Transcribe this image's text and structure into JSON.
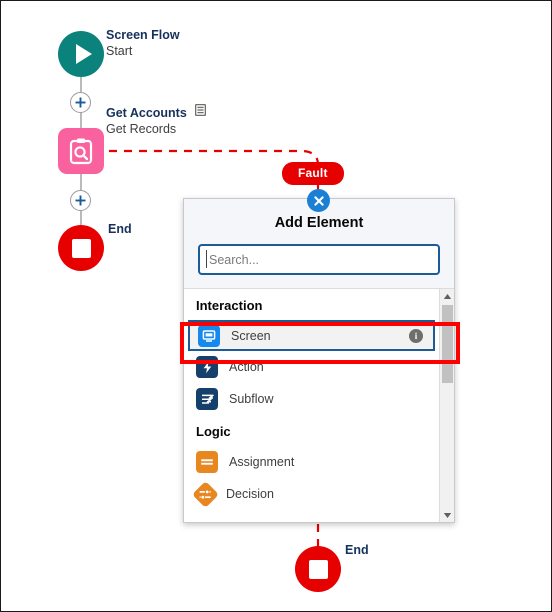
{
  "canvas": {
    "start_node": {
      "icon": "play-icon",
      "title": "Screen Flow",
      "subtitle": "Start",
      "color": "#0b827c"
    },
    "get_records_node": {
      "icon": "get-records-icon",
      "title": "Get Accounts",
      "subtitle": "Get Records",
      "badge_icon": "record-list-icon",
      "color": "#f9629f"
    },
    "end_node_main": {
      "icon": "end-icon",
      "label": "End",
      "color": "#e60000"
    },
    "end_node_fault": {
      "icon": "end-icon",
      "label": "End",
      "color": "#e60000"
    },
    "fault_badge": {
      "label": "Fault",
      "color": "#e60000"
    },
    "add_buttons": [
      {
        "name": "add-element-plus-top"
      },
      {
        "name": "add-element-plus-bottom"
      }
    ],
    "close_button": {
      "icon": "close-icon",
      "color": "#1b7fd4"
    }
  },
  "panel": {
    "title": "Add Element",
    "search": {
      "value": "",
      "placeholder": "Search..."
    },
    "sections": [
      {
        "header": "Interaction",
        "items": [
          {
            "label": "Screen",
            "icon": "screen-icon",
            "color": "#1589ee",
            "selected": true,
            "has_info": true
          },
          {
            "label": "Action",
            "icon": "action-icon",
            "color": "#14406b",
            "selected": false,
            "has_info": false
          },
          {
            "label": "Subflow",
            "icon": "subflow-icon",
            "color": "#14406b",
            "selected": false,
            "has_info": false
          }
        ]
      },
      {
        "header": "Logic",
        "items": [
          {
            "label": "Assignment",
            "icon": "assignment-icon",
            "color": "#e8871f",
            "selected": false,
            "has_info": false
          },
          {
            "label": "Decision",
            "icon": "decision-icon",
            "color": "#e8871f",
            "selected": false,
            "has_info": false
          }
        ]
      }
    ],
    "scrollbar": {
      "up_icon": "caret-up-icon",
      "down_icon": "caret-down-icon"
    }
  },
  "annotation": {
    "highlight_color": "#ff0000",
    "target": "Screen"
  }
}
